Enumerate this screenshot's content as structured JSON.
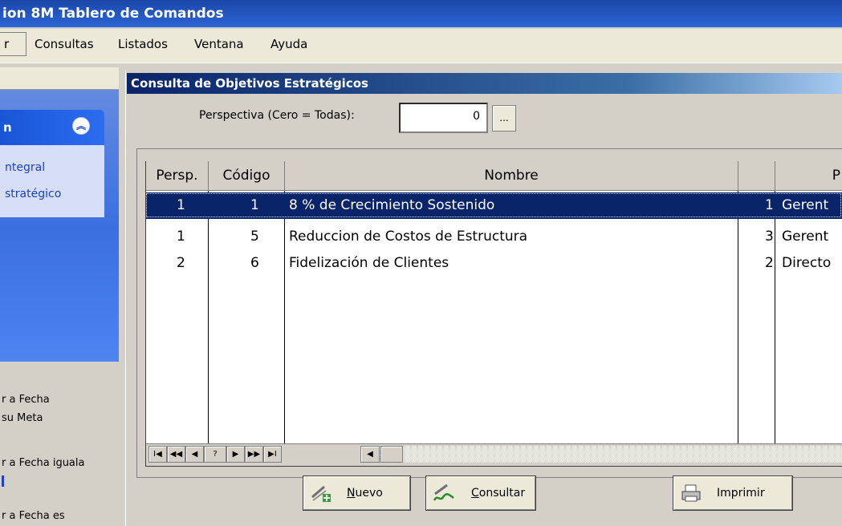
{
  "window": {
    "title": "ion 8M Tablero de Comandos"
  },
  "menu": {
    "items": [
      "r",
      "Consultas",
      "Listados",
      "Ventana",
      "Ayuda"
    ]
  },
  "sidebar": {
    "group_title": "n",
    "links": [
      "ntegral",
      "stratégico"
    ],
    "lower_texts": [
      "r a Fecha",
      "su Meta",
      "r a Fecha iguala",
      "",
      "r a Fecha es"
    ]
  },
  "child": {
    "title": "Consulta de Objetivos Estratégicos",
    "perspective_label": "Perspectiva (Cero = Todas):",
    "perspective_value": "0",
    "browse_label": "...",
    "grid": {
      "headers": [
        "Persp.",
        "Código",
        "Nombre",
        "",
        "P"
      ],
      "rows": [
        {
          "persp": "1",
          "codigo": "1",
          "nombre": "8 % de Crecimiento Sostenido",
          "n": "1",
          "resp": "Gerent"
        },
        {
          "persp": "1",
          "codigo": "5",
          "nombre": "Reduccion de Costos de Estructura",
          "n": "3",
          "resp": "Gerent"
        },
        {
          "persp": "2",
          "codigo": "6",
          "nombre": "Fidelización de Clientes",
          "n": "2",
          "resp": "Directo"
        }
      ]
    },
    "nav_buttons": [
      "I◀",
      "◀◀",
      "◀",
      "?",
      "▶",
      "▶▶",
      "▶I"
    ],
    "buttons": {
      "nuevo_first": "N",
      "nuevo_rest": "uevo",
      "consultar_first": "C",
      "consultar_rest": "onsultar",
      "imprimir": "Imprimir"
    }
  },
  "colors": {
    "titlebar": "#2d66d6",
    "selection": "#0a246a",
    "panel": "#d4d0c8"
  }
}
